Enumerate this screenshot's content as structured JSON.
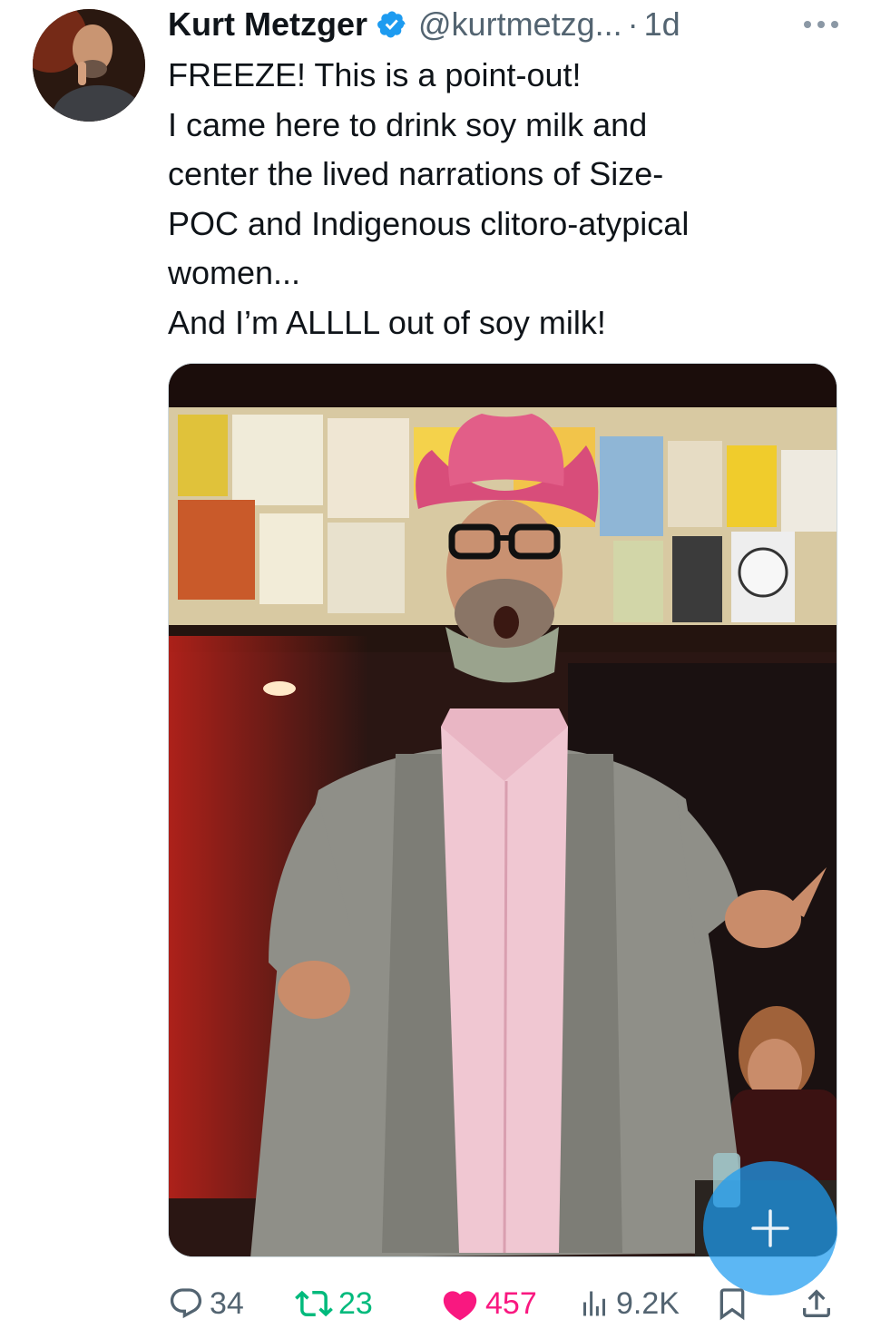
{
  "author": {
    "name": "Kurt Metzger",
    "handle": "@kurtmetzg...",
    "separator": "·",
    "time": "1d"
  },
  "tweet": {
    "lines": [
      "FREEZE! This is a point-out!",
      "I came here to drink soy milk and",
      "center the lived narrations of Size-",
      "POC and Indigenous clitoro-atypical",
      "women...",
      "And I’m ALLLL out of soy milk!"
    ]
  },
  "actions": {
    "replies": "34",
    "retweets": "23",
    "likes": "457",
    "views": "9.2K"
  },
  "colors": {
    "accent": "#1d9bf0",
    "retweet": "#00ba7c",
    "like": "#f91880",
    "muted": "#536471"
  },
  "icons": [
    "verified-badge-icon",
    "more-icon",
    "reply-icon",
    "retweet-icon",
    "heart-icon",
    "views-icon",
    "bookmark-icon",
    "share-icon",
    "compose-plus-icon"
  ]
}
